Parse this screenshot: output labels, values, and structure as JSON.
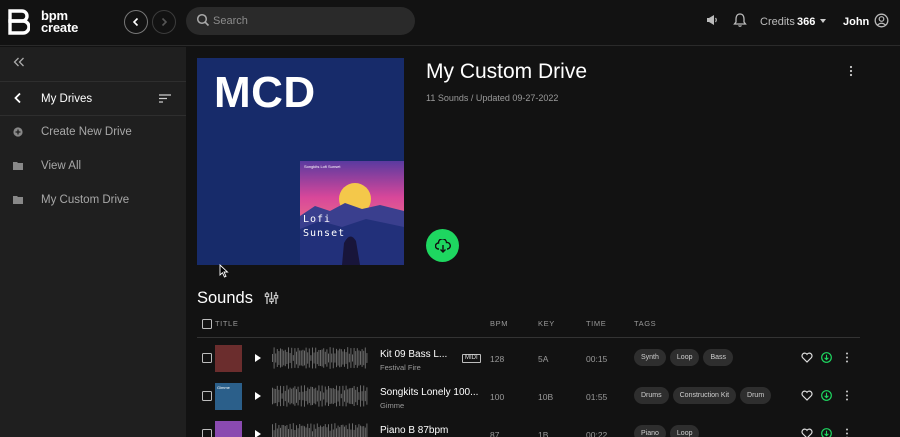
{
  "header": {
    "brand_line1": "bpm",
    "brand_line2": "create",
    "search_placeholder": "Search",
    "credits_label": "Credits",
    "credits_value": "366",
    "user_name": "John"
  },
  "sidebar": {
    "section_title": "My Drives",
    "items": [
      {
        "label": "Create New Drive",
        "icon": "plus-circle-icon"
      },
      {
        "label": "View All",
        "icon": "folder-icon"
      },
      {
        "label": "My Custom Drive",
        "icon": "folder-icon"
      }
    ]
  },
  "drive": {
    "cover_text": "MCD",
    "mini_cover_line1": "Lofi",
    "mini_cover_line2": "Sunset",
    "mini_cover_caption": "Songkits Lofi Sunset",
    "title": "My Custom Drive",
    "meta": "11 Sounds / Updated 09-27-2022"
  },
  "sounds": {
    "title": "Sounds",
    "columns": [
      "TITLE",
      "BPM",
      "KEY",
      "TIME",
      "TAGS"
    ],
    "rows": [
      {
        "title": "Kit 09 Bass L...",
        "subtitle": "Festival Fire",
        "midi": "MIDI",
        "bpm": "128",
        "key": "5A",
        "time": "00:15",
        "tags": [
          "Synth",
          "Loop",
          "Bass"
        ],
        "thumb_text": "",
        "thumb_color": "#6b2d2d"
      },
      {
        "title": "Songkits Lonely 100...",
        "subtitle": "Gimme",
        "midi": "",
        "bpm": "100",
        "key": "10B",
        "time": "01:55",
        "tags": [
          "Drums",
          "Construction Kit",
          "Drum"
        ],
        "thumb_text": "Gimme",
        "thumb_color": "#2b5f8a"
      },
      {
        "title": "Piano B 87bpm",
        "subtitle": "",
        "midi": "",
        "bpm": "87",
        "key": "1B",
        "time": "00:22",
        "tags": [
          "Piano",
          "Loop"
        ],
        "thumb_text": "",
        "thumb_color": "#8a4ab0"
      }
    ]
  },
  "colors": {
    "accent": "#1ed760",
    "background": "#121212",
    "sidebar": "#1f1f1f",
    "cover": "#172b6a"
  }
}
